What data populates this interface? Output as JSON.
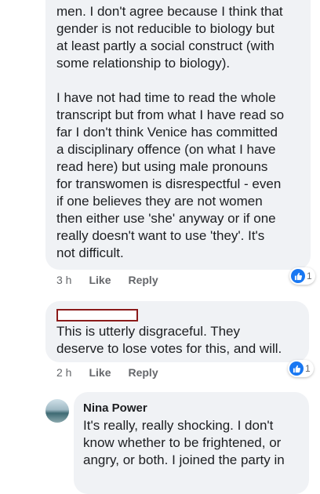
{
  "comments": [
    {
      "text": "men. I don't agree because I think that\ngender is not reducible to biology but\nat least partly a social construct (with\nsome relationship to biology).\n\nI have not had time to read the whole\ntranscript but from what I have read so\nfar I don't think Venice has committed\na disciplinary offence (on what I have\nread here) but using male pronouns\nfor transwomen is disrespectful - even\nif one believes they are not women\nthen either use 'she' anyway or if one\nreally doesn't want to use 'they'. It's\nnot difficult.",
      "time": "3 h",
      "like_label": "Like",
      "reply_label": "Reply",
      "reaction_count": "1"
    },
    {
      "author_redacted": true,
      "text": "This is utterly disgraceful. They\ndeserve to lose votes for this, and will.",
      "time": "2 h",
      "like_label": "Like",
      "reply_label": "Reply",
      "reaction_count": "1"
    },
    {
      "author": "Nina Power",
      "text": "It's really, really shocking. I don't\nknow whether to be frightened, or\nangry, or both. I joined the party in"
    }
  ],
  "icons": {
    "reaction": "thumbs-up-icon",
    "avatar": "avatar"
  },
  "colors": {
    "like_blue": "#1877f2",
    "redaction_border": "#8b1a1a",
    "bubble": "#f0f2f5"
  }
}
